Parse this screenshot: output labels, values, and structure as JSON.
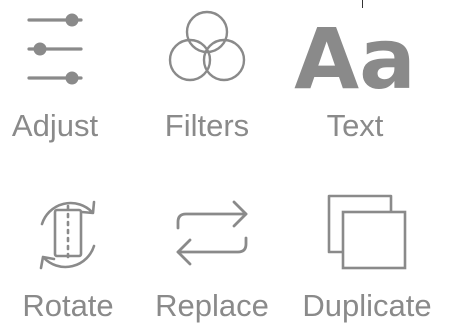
{
  "tools": [
    {
      "label": "Adjust",
      "icon": "sliders-icon"
    },
    {
      "label": "Filters",
      "icon": "overlapping-circles-icon"
    },
    {
      "label": "Text",
      "icon": "text-aa-icon",
      "icon_text": "Aa"
    },
    {
      "label": "Rotate",
      "icon": "rotate-icon"
    },
    {
      "label": "Replace",
      "icon": "swap-arrows-icon"
    },
    {
      "label": "Duplicate",
      "icon": "duplicate-icon"
    }
  ],
  "colors": {
    "icon": "#8a8a8a",
    "label": "#8a8a8a",
    "background": "#ffffff"
  }
}
